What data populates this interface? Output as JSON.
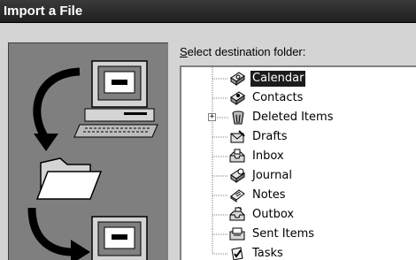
{
  "window": {
    "title": "Import a File"
  },
  "main": {
    "prompt_accel": "S",
    "prompt_rest": "elect destination folder:"
  },
  "folders": [
    {
      "label": "Calendar",
      "icon": "calendar-icon",
      "selected": true
    },
    {
      "label": "Contacts",
      "icon": "contacts-icon"
    },
    {
      "label": "Deleted Items",
      "icon": "deleted-items-icon",
      "expandable": true,
      "expander": "+"
    },
    {
      "label": "Drafts",
      "icon": "drafts-icon"
    },
    {
      "label": "Inbox",
      "icon": "inbox-icon"
    },
    {
      "label": "Journal",
      "icon": "journal-icon"
    },
    {
      "label": "Notes",
      "icon": "notes-icon"
    },
    {
      "label": "Outbox",
      "icon": "outbox-icon"
    },
    {
      "label": "Sent Items",
      "icon": "sent-items-icon"
    },
    {
      "label": "Tasks",
      "icon": "tasks-icon"
    }
  ]
}
